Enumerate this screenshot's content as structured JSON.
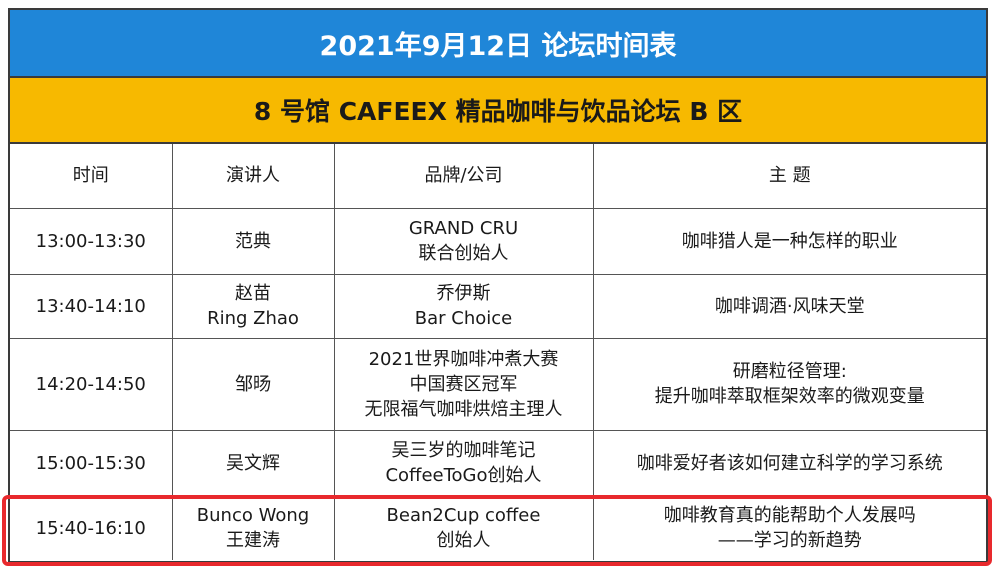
{
  "title": "2021年9月12日  论坛时间表",
  "subtitle": "8 号馆 CAFEEX 精品咖啡与饮品论坛 B 区",
  "colors": {
    "title_bg": "#1f86d8",
    "subtitle_bg": "#f7b900",
    "highlight": "#e8292d"
  },
  "headers": [
    "时间",
    "演讲人",
    "品牌/公司",
    "主 题"
  ],
  "rows": [
    {
      "time": "13:00-13:30",
      "speaker": [
        "范典"
      ],
      "company": [
        "GRAND CRU",
        "联合创始人"
      ],
      "topic": [
        "咖啡猎人是一种怎样的职业"
      ]
    },
    {
      "time": "13:40-14:10",
      "speaker": [
        "赵苗",
        "Ring Zhao"
      ],
      "company": [
        "乔伊斯",
        "Bar Choice"
      ],
      "topic": [
        "咖啡调酒·风味天堂"
      ]
    },
    {
      "time": "14:20-14:50",
      "speaker": [
        "邹旸"
      ],
      "company": [
        "2021世界咖啡冲煮大赛",
        "中国赛区冠军",
        "无限福气咖啡烘焙主理人"
      ],
      "topic": [
        "研磨粒径管理:",
        "提升咖啡萃取框架效率的微观变量"
      ]
    },
    {
      "time": "15:00-15:30",
      "speaker": [
        "吴文辉"
      ],
      "company": [
        "吴三岁的咖啡笔记",
        "CoffeeToGo创始人"
      ],
      "topic": [
        "咖啡爱好者该如何建立科学的学习系统"
      ]
    },
    {
      "time": "15:40-16:10",
      "speaker": [
        "Bunco Wong",
        "王建涛"
      ],
      "company": [
        "Bean2Cup coffee",
        "创始人"
      ],
      "topic": [
        "咖啡教育真的能帮助个人发展吗",
        "——学习的新趋势"
      ]
    }
  ]
}
